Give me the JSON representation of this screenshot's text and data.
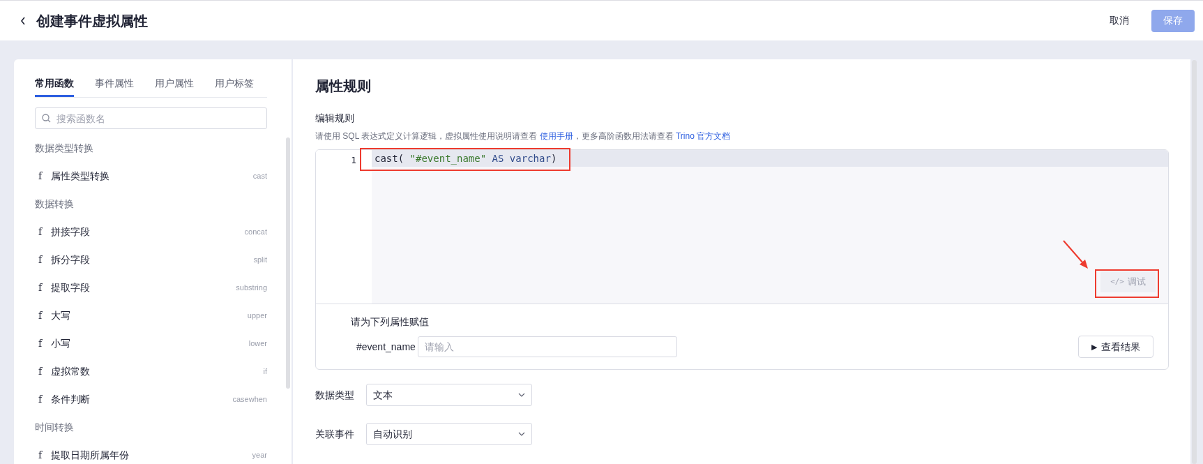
{
  "header": {
    "title": "创建事件虚拟属性",
    "buttons": [
      {
        "label": "取消",
        "kind": "text",
        "disabled": false
      },
      {
        "label": "保存",
        "kind": "primary",
        "disabled": true
      }
    ]
  },
  "sidebar": {
    "tabs": [
      {
        "label": "常用函数",
        "selected": true
      },
      {
        "label": "事件属性",
        "selected": false
      },
      {
        "label": "用户属性",
        "selected": false
      },
      {
        "label": "用户标签",
        "selected": false
      }
    ],
    "search": {
      "placeholder": "搜索函数名"
    },
    "groups": [
      {
        "title": "数据类型转换",
        "items": [
          {
            "icon": "f",
            "name": "属性类型转换",
            "function": "cast"
          }
        ]
      },
      {
        "title": "数据转换",
        "items": [
          {
            "icon": "f",
            "name": "拼接字段",
            "function": "concat"
          },
          {
            "icon": "f",
            "name": "拆分字段",
            "function": "split"
          },
          {
            "icon": "f",
            "name": "提取字段",
            "function": "substring"
          },
          {
            "icon": "f",
            "name": "大写",
            "function": "upper"
          },
          {
            "icon": "f",
            "name": "小写",
            "function": "lower"
          },
          {
            "icon": "f",
            "name": "虚拟常数",
            "function": "if"
          },
          {
            "icon": "f",
            "name": "条件判断",
            "function": "casewhen"
          }
        ]
      },
      {
        "title": "时间转换",
        "items": [
          {
            "icon": "f",
            "name": "提取日期所属年份",
            "function": "year"
          }
        ]
      }
    ]
  },
  "rule": {
    "title": "属性规则",
    "section": "编辑规则",
    "description": [
      {
        "kind": "text",
        "text": "请使用 SQL 表达式定义计算逻辑，虚拟属性使用说明请查看 "
      },
      {
        "kind": "link",
        "text": "使用手册"
      },
      {
        "kind": "text",
        "text": "，更多高阶函数用法请查看 "
      },
      {
        "kind": "link",
        "text": "Trino 官方文档"
      }
    ],
    "editor": {
      "lines": [
        {
          "number": "1",
          "tokens": [
            {
              "kind": "plain",
              "text": "cast( "
            },
            {
              "kind": "string",
              "text": "\"#event_name\""
            },
            {
              "kind": "keyword",
              "text": " AS varchar"
            },
            {
              "kind": "plain",
              "text": ")"
            }
          ]
        }
      ],
      "debug_button": {
        "icon": "</>",
        "label": "调试",
        "disabled": true
      }
    },
    "assign": {
      "title": "请为下列属性赋值",
      "fields": [
        {
          "label": "#event_name",
          "placeholder": "请输入"
        }
      ],
      "run_button": {
        "icon": "▶",
        "label": "查看结果"
      }
    },
    "form": [
      {
        "label": "数据类型",
        "value": "文本"
      },
      {
        "label": "关联事件",
        "value": "自动识别"
      }
    ]
  }
}
